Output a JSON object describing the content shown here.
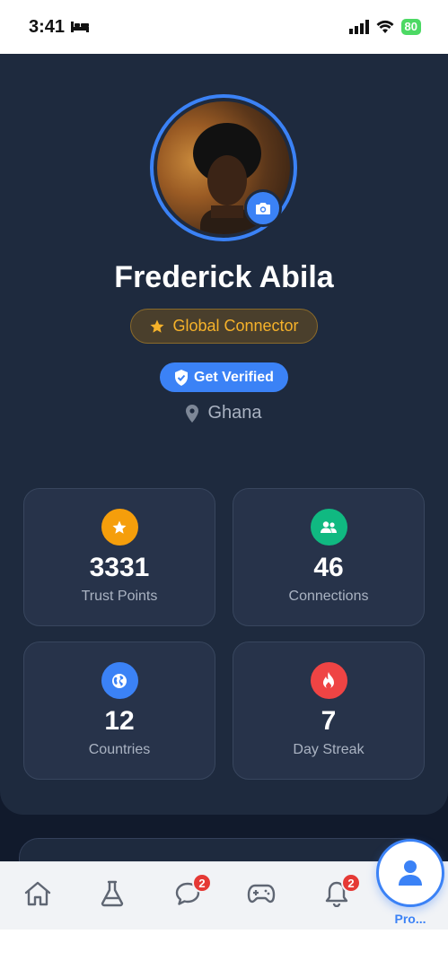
{
  "status_bar": {
    "time": "3:41",
    "battery": "80"
  },
  "profile": {
    "name": "Frederick Abila",
    "badge": "Global Connector",
    "verify_label": "Get Verified",
    "location": "Ghana"
  },
  "stats": [
    {
      "value": "3331",
      "label": "Trust Points",
      "icon": "star-icon",
      "color": "#f59e0b"
    },
    {
      "value": "46",
      "label": "Connections",
      "icon": "people-icon",
      "color": "#10b981"
    },
    {
      "value": "12",
      "label": "Countries",
      "icon": "globe-icon",
      "color": "#3b82f6"
    },
    {
      "value": "7",
      "label": "Day Streak",
      "icon": "fire-icon",
      "color": "#ef4444"
    }
  ],
  "nav": {
    "items": [
      {
        "icon": "home-icon"
      },
      {
        "icon": "flask-icon"
      },
      {
        "icon": "chat-icon",
        "badge": "2"
      },
      {
        "icon": "gamepad-icon"
      },
      {
        "icon": "bell-icon",
        "badge": "2"
      }
    ],
    "profile_label": "Pro..."
  },
  "colors": {
    "accent": "#3b82f6",
    "background": "#1e2a3e",
    "badge_gold": "#f6b22a"
  }
}
